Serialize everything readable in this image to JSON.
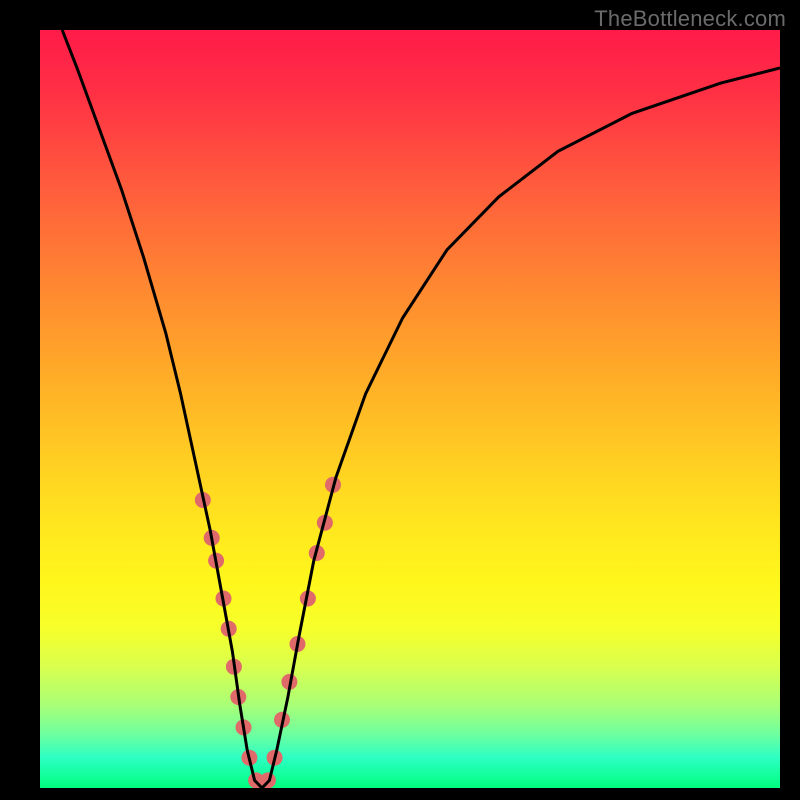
{
  "watermark": "TheBottleneck.com",
  "chart_data": {
    "type": "line",
    "title": "",
    "xlabel": "",
    "ylabel": "",
    "xlim": [
      0,
      100
    ],
    "ylim": [
      0,
      100
    ],
    "grid": false,
    "legend": false,
    "series": [
      {
        "name": "curve",
        "x": [
          3,
          5,
          8,
          11,
          14,
          17,
          19,
          21,
          23,
          24.5,
          26,
          27,
          28,
          29,
          30,
          31,
          32,
          33.5,
          35,
          37,
          40,
          44,
          49,
          55,
          62,
          70,
          80,
          92,
          100
        ],
        "y": [
          100,
          95,
          87,
          79,
          70,
          60,
          52,
          43,
          34,
          26,
          18,
          11,
          5,
          1,
          0,
          1,
          5,
          12,
          20,
          30,
          41,
          52,
          62,
          71,
          78,
          84,
          89,
          93,
          95
        ],
        "stroke": "#000000",
        "stroke_width": 3
      }
    ],
    "markers": [
      {
        "cx": 22.0,
        "cy": 38,
        "r": 8
      },
      {
        "cx": 23.2,
        "cy": 33,
        "r": 8
      },
      {
        "cx": 23.8,
        "cy": 30,
        "r": 8
      },
      {
        "cx": 24.8,
        "cy": 25,
        "r": 8
      },
      {
        "cx": 25.5,
        "cy": 21,
        "r": 8
      },
      {
        "cx": 26.2,
        "cy": 16,
        "r": 8
      },
      {
        "cx": 26.8,
        "cy": 12,
        "r": 8
      },
      {
        "cx": 27.5,
        "cy": 8,
        "r": 8
      },
      {
        "cx": 28.3,
        "cy": 4,
        "r": 8
      },
      {
        "cx": 29.2,
        "cy": 1,
        "r": 8
      },
      {
        "cx": 30.0,
        "cy": 0,
        "r": 8
      },
      {
        "cx": 30.8,
        "cy": 1,
        "r": 8
      },
      {
        "cx": 31.7,
        "cy": 4,
        "r": 8
      },
      {
        "cx": 32.7,
        "cy": 9,
        "r": 8
      },
      {
        "cx": 33.7,
        "cy": 14,
        "r": 8
      },
      {
        "cx": 34.8,
        "cy": 19,
        "r": 8
      },
      {
        "cx": 36.2,
        "cy": 25,
        "r": 8
      },
      {
        "cx": 37.4,
        "cy": 31,
        "r": 8
      },
      {
        "cx": 38.5,
        "cy": 35,
        "r": 8
      },
      {
        "cx": 39.6,
        "cy": 40,
        "r": 8
      }
    ],
    "marker_fill": "#e06a6a",
    "background_gradient": {
      "top": "#ff1b49",
      "bottom": "#00ff7f"
    }
  }
}
